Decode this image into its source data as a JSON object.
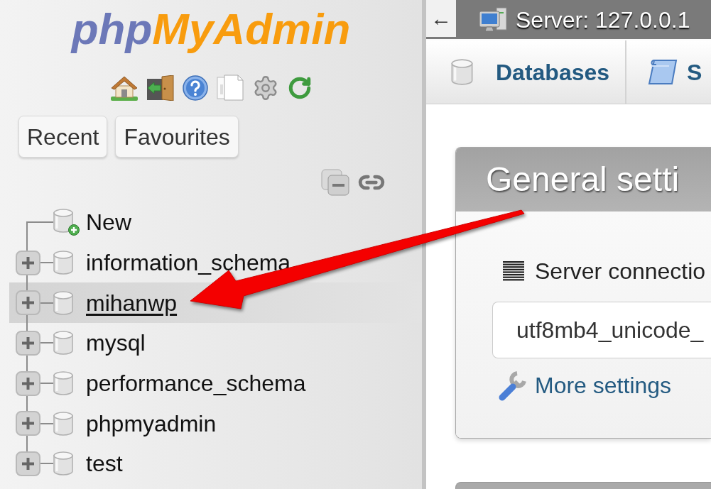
{
  "sidebar": {
    "logo": {
      "prefix": "php",
      "suffix": "MyAdmin"
    },
    "buttons": [
      {
        "label": "Recent"
      },
      {
        "label": "Favourites"
      }
    ],
    "tree": [
      {
        "kind": "new",
        "label": "New"
      },
      {
        "kind": "database",
        "label": "information_schema",
        "expanded": false,
        "selected": false
      },
      {
        "kind": "database",
        "label": "mihanwp",
        "expanded": false,
        "selected": true
      },
      {
        "kind": "database",
        "label": "mysql",
        "expanded": false,
        "selected": false
      },
      {
        "kind": "database",
        "label": "performance_schema",
        "expanded": false,
        "selected": false
      },
      {
        "kind": "database",
        "label": "phpmyadmin",
        "expanded": false,
        "selected": false
      },
      {
        "kind": "database",
        "label": "test",
        "expanded": false,
        "selected": false
      }
    ]
  },
  "topbar": {
    "back": "←",
    "breadcrumb": "Server: 127.0.0.1"
  },
  "tabs": [
    {
      "kind": "database",
      "label": "Databases"
    },
    {
      "kind": "sql",
      "label": "S"
    }
  ],
  "panel": {
    "title": "General setti",
    "field_label": "Server connectio",
    "select_value": "utf8mb4_unicode_",
    "link": "More settings"
  }
}
